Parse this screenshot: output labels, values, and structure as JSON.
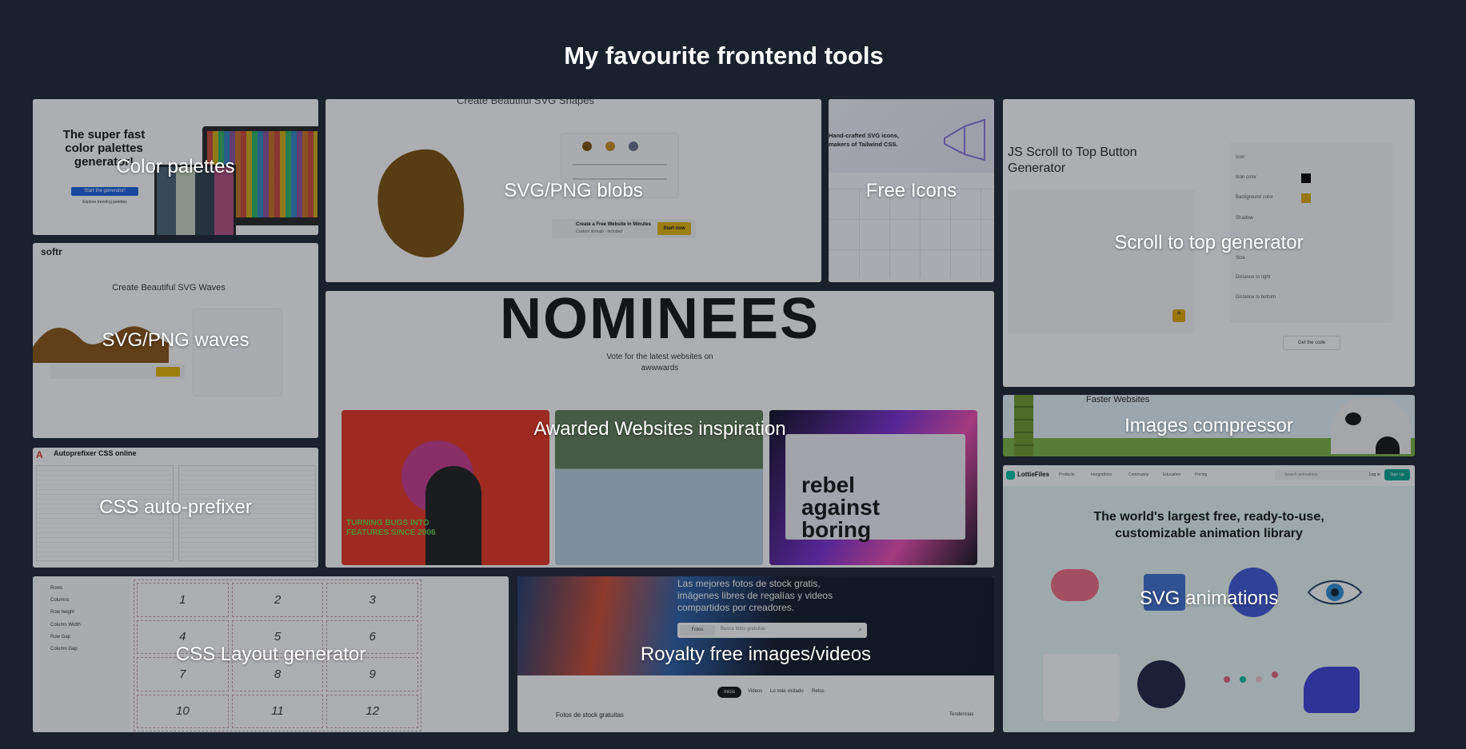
{
  "page": {
    "title": "My favourite frontend tools"
  },
  "cards": {
    "color_palettes": {
      "label": "Color palettes",
      "preview": {
        "headline": "The super fast color palettes generator!",
        "button": "Start the generator!",
        "link": "Explore trending palettes"
      }
    },
    "svg_blobs": {
      "label": "SVG/PNG blobs",
      "preview": {
        "heading": "Create Beautiful SVG Shapes",
        "promo": "Create a Free Website in Minutes",
        "promo_sub": "Custom domain · included",
        "cta": "Start now"
      }
    },
    "free_icons": {
      "label": "Free Icons",
      "preview": {
        "headline": "Hand-crafted SVG icons, makers of Tailwind CSS."
      }
    },
    "scroll_to_top": {
      "label": "Scroll to top generator",
      "preview": {
        "heading": "JS Scroll to Top Button Generator",
        "rows": [
          "Icon",
          "Icon color",
          "Background color",
          "Shadow",
          "Size",
          "Distance to right",
          "Distance to bottom"
        ],
        "button": "Get the code"
      }
    },
    "svg_waves": {
      "label": "SVG/PNG waves",
      "preview": {
        "brand": "softr",
        "heading": "Create Beautiful SVG Waves"
      }
    },
    "awwwards": {
      "label": "Awarded Websites inspiration",
      "preview": {
        "big_word": "NOMINEES",
        "subtitle": "Vote for the latest websites on awwwards",
        "tile1_text": "TURNING BUGS INTO FEATURES SINCE 2006",
        "tile3_text": "rebel against boring"
      }
    },
    "images_compressor": {
      "label": "Images compressor",
      "preview": {
        "heading": "Faster Websites"
      }
    },
    "autoprefixer": {
      "label": "CSS auto-prefixer",
      "preview": {
        "title": "Autoprefixer CSS online"
      }
    },
    "svg_animations": {
      "label": "SVG animations",
      "preview": {
        "brand": "LottieFiles",
        "nav": [
          "Products",
          "Integrations",
          "Community",
          "Education",
          "Pricing"
        ],
        "search": "Search animations",
        "login": "Log in",
        "signup": "Sign Up",
        "headline": "The world's largest free, ready-to-use, customizable animation library"
      }
    },
    "css_layout": {
      "label": "CSS Layout generator",
      "preview": {
        "settings": [
          "Rows",
          "Columns",
          "Row height",
          "Column Width",
          "Row Gap",
          "Column Gap"
        ],
        "cells": [
          "1",
          "2",
          "3",
          "4",
          "5",
          "6",
          "7",
          "8",
          "9",
          "10",
          "11",
          "12"
        ]
      }
    },
    "royalty_free": {
      "label": "Royalty free images/videos",
      "preview": {
        "headline": "Las mejores fotos de stock gratis, imágenes libres de regalías y videos compartidos por creadores.",
        "search_scope": "Fotos",
        "search": "Busca fotos gratuitas",
        "tabs": [
          "Inicio",
          "Videos",
          "Lo más visitado",
          "Retos"
        ],
        "section": "Fotos de stock gratuitas",
        "trend": "Tendencias"
      }
    }
  }
}
